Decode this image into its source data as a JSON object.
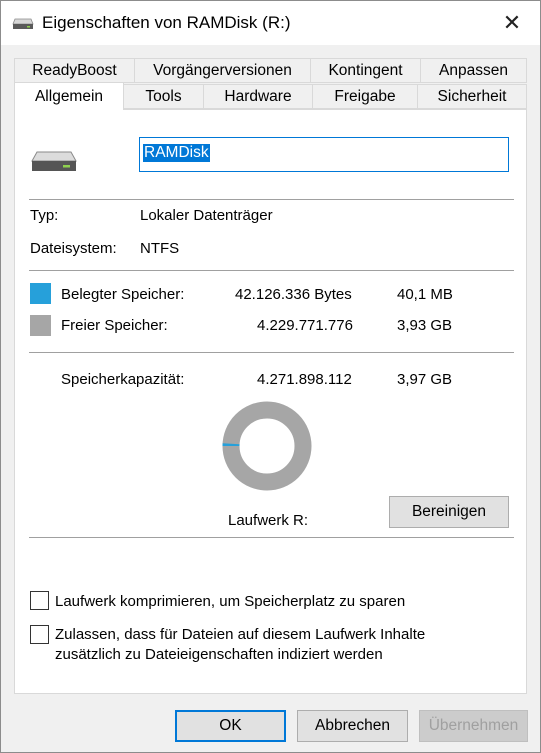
{
  "window": {
    "title": "Eigenschaften von RAMDisk (R:)",
    "close_glyph": "✕"
  },
  "tabs": {
    "row1": [
      "ReadyBoost",
      "Vorgängerversionen",
      "Kontingent",
      "Anpassen"
    ],
    "row2": [
      "Allgemein",
      "Tools",
      "Hardware",
      "Freigabe",
      "Sicherheit"
    ],
    "active": "Allgemein"
  },
  "general": {
    "drive_icon": "drive-icon",
    "name_value": "RAMDisk",
    "type_label": "Typ:",
    "type_value": "Lokaler Datenträger",
    "fs_label": "Dateisystem:",
    "fs_value": "NTFS",
    "used_label": "Belegter Speicher:",
    "used_bytes": "42.126.336 Bytes",
    "used_size": "40,1 MB",
    "used_color": "#26a0da",
    "free_label": "Freier Speicher:",
    "free_bytes": "4.229.771.776",
    "free_size": "3,93 GB",
    "free_color": "#a6a6a6",
    "capacity_label": "Speicherkapazität:",
    "capacity_bytes": "4.271.898.112",
    "capacity_size": "3,97 GB",
    "used_fraction": 0.00986,
    "drive_label": "Laufwerk R:",
    "cleanup_button": "Bereinigen",
    "compress_label": "Laufwerk komprimieren, um Speicherplatz zu sparen",
    "compress_checked": false,
    "index_label_line1": "Zulassen, dass für Dateien auf diesem Laufwerk Inhalte",
    "index_label_line2": "zusätzlich zu Dateieigenschaften indiziert werden",
    "index_checked": false
  },
  "buttons": {
    "ok": "OK",
    "cancel": "Abbrechen",
    "apply": "Übernehmen"
  }
}
